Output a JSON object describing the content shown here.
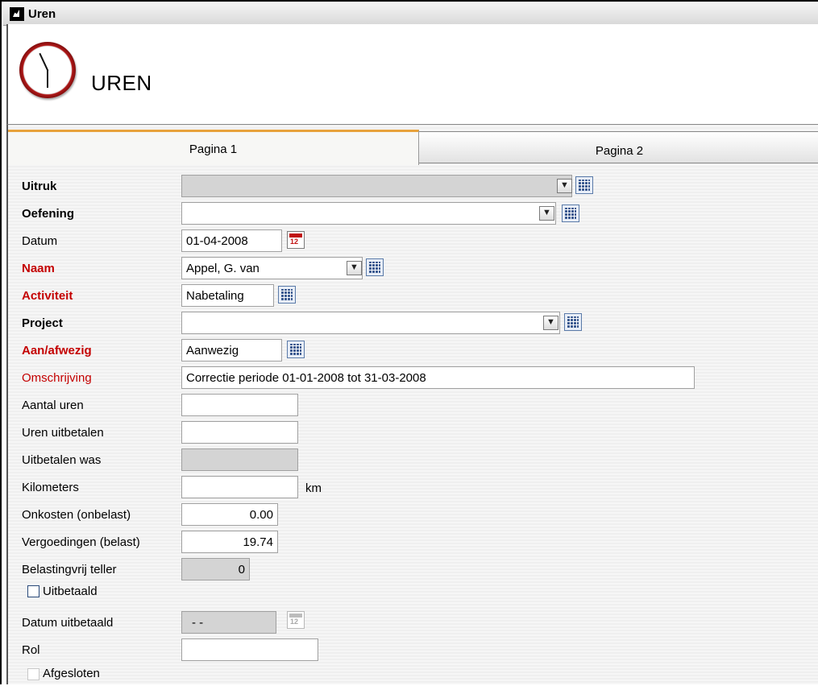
{
  "window": {
    "title": "Uren"
  },
  "header": {
    "heading": "UREN"
  },
  "tabs": [
    {
      "label": "Pagina 1"
    },
    {
      "label": "Pagina 2"
    }
  ],
  "form": {
    "uitruk": {
      "label": "Uitruk",
      "value": ""
    },
    "oefening": {
      "label": "Oefening",
      "value": ""
    },
    "datum": {
      "label": "Datum",
      "value": "01-04-2008"
    },
    "naam": {
      "label": "Naam",
      "value": "Appel, G. van"
    },
    "activiteit": {
      "label": "Activiteit",
      "value": "Nabetaling"
    },
    "project": {
      "label": "Project",
      "value": ""
    },
    "aanafwezig": {
      "label": "Aan/afwezig",
      "value": "Aanwezig"
    },
    "omschrijving": {
      "label": "Omschrijving",
      "value": "Correctie periode 01-01-2008 tot 31-03-2008"
    },
    "aantal_uren": {
      "label": "Aantal uren",
      "value": ""
    },
    "uren_uitbetalen": {
      "label": "Uren uitbetalen",
      "value": ""
    },
    "uitbetalen_was": {
      "label": "Uitbetalen was",
      "value": ""
    },
    "kilometers": {
      "label": "Kilometers",
      "value": "",
      "unit": "km"
    },
    "onkosten": {
      "label": "Onkosten (onbelast)",
      "value": "0.00"
    },
    "vergoedingen": {
      "label": "Vergoedingen (belast)",
      "value": "19.74"
    },
    "belastingvrij": {
      "label": "Belastingvrij teller",
      "value": "0"
    },
    "uitbetaald": {
      "label": "Uitbetaald",
      "checked": false
    },
    "datum_uitbetaald": {
      "label": "Datum uitbetaald",
      "value": "- -"
    },
    "rol": {
      "label": "Rol",
      "value": ""
    },
    "afgesloten": {
      "label": "Afgesloten",
      "checked": false
    }
  },
  "colors": {
    "required_label": "#c40000",
    "tab_accent": "#e8a23b",
    "disabled_field": "#d4d4d4"
  },
  "icons": {
    "dropdown": "chevron-down-icon",
    "lookup": "lookup-grid-icon",
    "calendar": "calendar-icon",
    "app": "app-icon",
    "clock": "clock-icon"
  }
}
